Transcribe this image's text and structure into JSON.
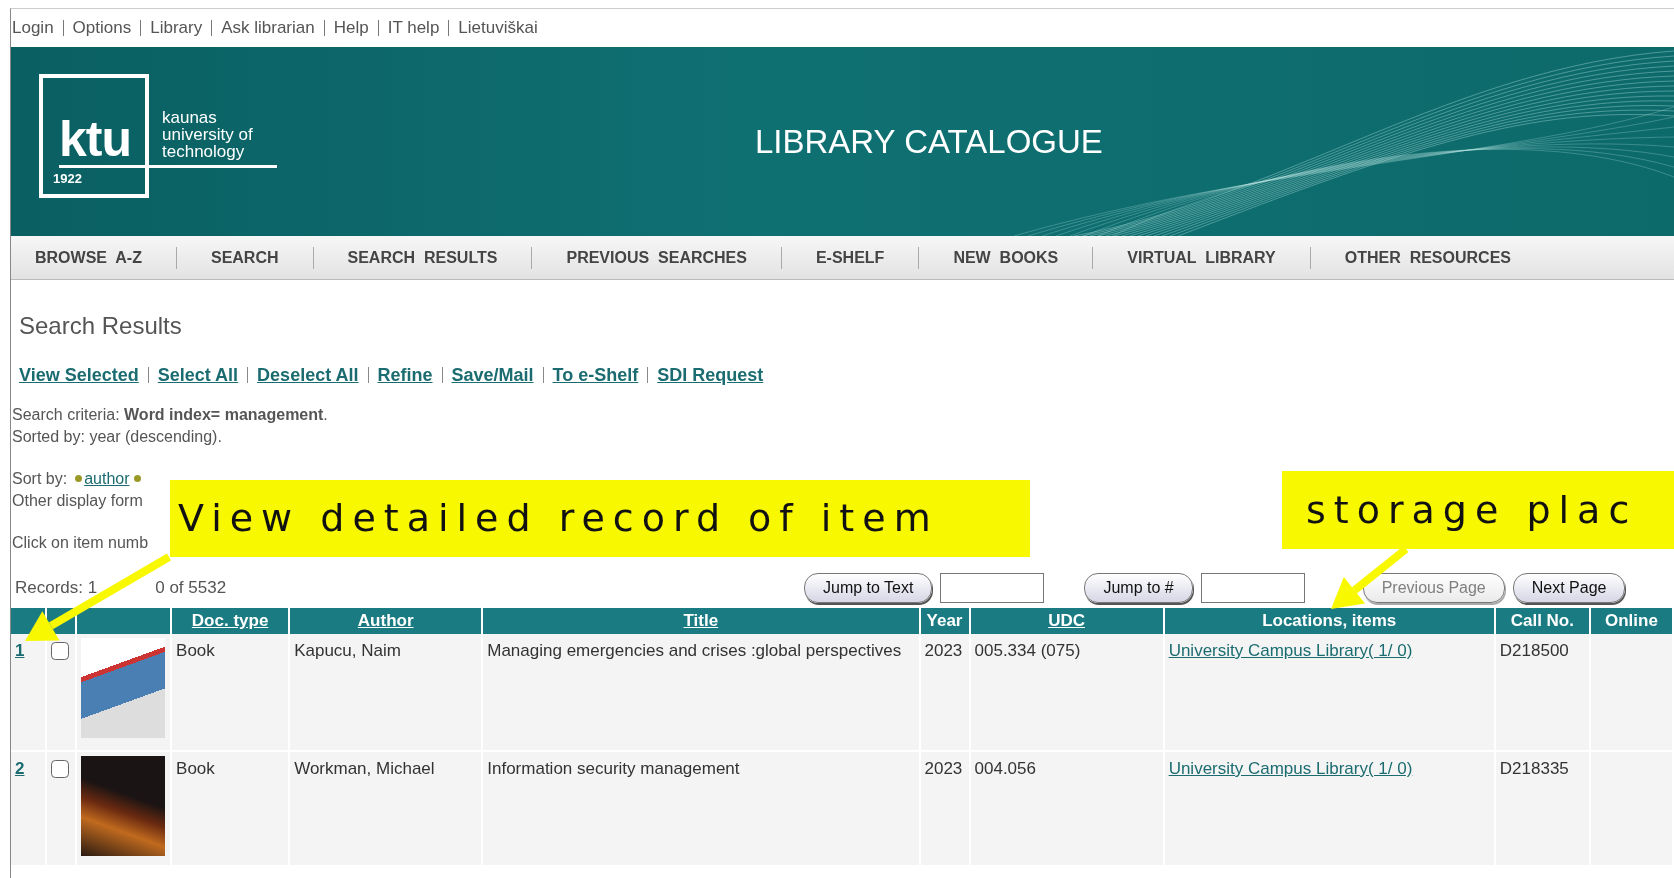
{
  "top_links": [
    "Login",
    "Options",
    "Library",
    "Ask librarian",
    "Help",
    "IT help",
    "Lietuviškai"
  ],
  "header": {
    "logo": {
      "mark": "ktu",
      "year": "1922",
      "name_lines": [
        "kaunas",
        "university of",
        "technology"
      ]
    },
    "title": "LIBRARY CATALOGUE"
  },
  "nav": [
    "BROWSE  A-Z",
    "SEARCH",
    "SEARCH  RESULTS",
    "PREVIOUS  SEARCHES",
    "E-SHELF",
    "NEW  BOOKS",
    "VIRTUAL  LIBRARY",
    "OTHER  RESOURCES"
  ],
  "page_title": "Search Results",
  "actions": [
    "View Selected",
    "Select All",
    "Deselect All",
    "Refine",
    "Save/Mail",
    "To e-Shelf",
    "SDI Request"
  ],
  "criteria": "Search criteria: **Word index= management**.",
  "sorted_by": "Sorted by: year (descending).",
  "sort_by": {
    "label": "Sort by:",
    "options": [
      "author"
    ]
  },
  "other_display": "Other display form",
  "click_hint": "Click on item numb",
  "records": [
    "Records: 1",
    "0 of 5532"
  ],
  "jump": [
    "Jump to Text",
    "Jump to #"
  ],
  "pager": [
    {
      "label": "Previous Page",
      "disabled": true
    },
    {
      "label": "Next Page",
      "disabled": false
    }
  ],
  "table": {
    "columns": [
      {
        "label": "Doc. type",
        "sortable": true
      },
      {
        "label": "Author",
        "sortable": true
      },
      {
        "label": "Title",
        "sortable": true
      },
      {
        "label": "Year",
        "sortable": false
      },
      {
        "label": "UDC",
        "sortable": true
      },
      {
        "label": "Locations, items",
        "sortable": false
      },
      {
        "label": "Call No.",
        "sortable": false
      },
      {
        "label": "Online",
        "sortable": false
      }
    ],
    "rows": [
      {
        "number": "1",
        "checked": false,
        "doc_type": "Book",
        "author": "Kapucu, Naim",
        "title": "Managing emergencies and crises :global perspectives",
        "year": "2023",
        "udc": "005.334 (075)",
        "location": "University Campus Library( 1/ 0)",
        "call_no": "D218500"
      },
      {
        "number": "2",
        "checked": false,
        "doc_type": "Book",
        "author": "Workman, Michael",
        "title": "Information security management",
        "year": "2023",
        "udc": "004.056",
        "location": "University Campus Library( 1/ 0)",
        "call_no": "D218335"
      }
    ]
  },
  "callouts": [
    {
      "text": "View detailed record of item"
    },
    {
      "text": "storage plac"
    }
  ]
}
